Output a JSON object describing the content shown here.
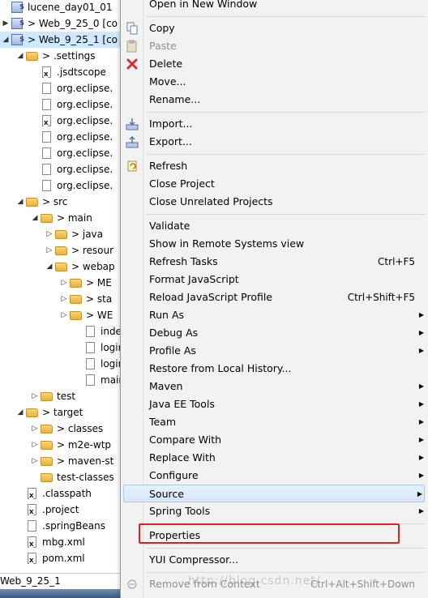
{
  "tree": {
    "rows": [
      {
        "label": "lucene_day01_01",
        "icon": "project-icon",
        "toggle": "",
        "indent": 0
      },
      {
        "label": "> Web_9_25_0 [co",
        "icon": "maven-project-icon",
        "toggle": "▶",
        "indent": 0
      },
      {
        "label": "> Web_9_25_1 [co",
        "icon": "maven-project-icon",
        "toggle": "◢",
        "indent": 0,
        "selected": true
      },
      {
        "label": "> .settings",
        "icon": "folder-icon",
        "toggle": "◢",
        "indent": 1
      },
      {
        "label": ".jsdtscope",
        "icon": "xml-file-icon",
        "toggle": "",
        "indent": 2
      },
      {
        "label": "org.eclipse.",
        "icon": "file-icon",
        "toggle": "",
        "indent": 2
      },
      {
        "label": "org.eclipse.",
        "icon": "file-icon",
        "toggle": "",
        "indent": 2
      },
      {
        "label": "org.eclipse.",
        "icon": "xml-file-icon",
        "toggle": "",
        "indent": 2
      },
      {
        "label": "org.eclipse.",
        "icon": "file-icon",
        "toggle": "",
        "indent": 2
      },
      {
        "label": "org.eclipse.",
        "icon": "file-icon",
        "toggle": "",
        "indent": 2
      },
      {
        "label": "org.eclipse.",
        "icon": "file-icon",
        "toggle": "",
        "indent": 2
      },
      {
        "label": "org.eclipse.",
        "icon": "file-icon",
        "toggle": "",
        "indent": 2
      },
      {
        "label": "> src",
        "icon": "folder-icon",
        "toggle": "◢",
        "indent": 1
      },
      {
        "label": "> main",
        "icon": "folder-icon",
        "toggle": "◢",
        "indent": 2
      },
      {
        "label": "> java",
        "icon": "folder-icon",
        "toggle": "▷",
        "indent": 3
      },
      {
        "label": "> resour",
        "icon": "folder-icon",
        "toggle": "▷",
        "indent": 3
      },
      {
        "label": "> webap",
        "icon": "folder-icon",
        "toggle": "◢",
        "indent": 3
      },
      {
        "label": "> ME",
        "icon": "folder-icon",
        "toggle": "▷",
        "indent": 4
      },
      {
        "label": "> sta",
        "icon": "folder-icon",
        "toggle": "▷",
        "indent": 4
      },
      {
        "label": "> WE",
        "icon": "folder-icon",
        "toggle": "▷",
        "indent": 4
      },
      {
        "label": "index",
        "icon": "file-icon",
        "toggle": "",
        "indent": 5
      },
      {
        "label": "login",
        "icon": "file-icon",
        "toggle": "",
        "indent": 5
      },
      {
        "label": "login",
        "icon": "file-icon",
        "toggle": "",
        "indent": 5
      },
      {
        "label": "main",
        "icon": "file-icon",
        "toggle": "",
        "indent": 5
      },
      {
        "label": "test",
        "icon": "folder-icon",
        "toggle": "▷",
        "indent": 2
      },
      {
        "label": "> target",
        "icon": "folder-icon",
        "toggle": "◢",
        "indent": 1
      },
      {
        "label": "> classes",
        "icon": "folder-icon",
        "toggle": "▷",
        "indent": 2
      },
      {
        "label": "> m2e-wtp",
        "icon": "folder-icon",
        "toggle": "▷",
        "indent": 2
      },
      {
        "label": "> maven-st",
        "icon": "folder-icon",
        "toggle": "▷",
        "indent": 2
      },
      {
        "label": "test-classes",
        "icon": "folder-icon",
        "toggle": "",
        "indent": 2
      },
      {
        "label": ".classpath",
        "icon": "xml-file-icon",
        "toggle": "",
        "indent": 1
      },
      {
        "label": ".project",
        "icon": "xml-file-icon",
        "toggle": "",
        "indent": 1
      },
      {
        "label": ".springBeans",
        "icon": "file-icon",
        "toggle": "",
        "indent": 1
      },
      {
        "label": "mbg.xml",
        "icon": "xml-file-icon",
        "toggle": "",
        "indent": 1
      },
      {
        "label": "pom.xml",
        "icon": "xml-file-icon",
        "toggle": "",
        "indent": 1
      }
    ]
  },
  "status": {
    "label": "Web_9_25_1"
  },
  "menu": {
    "items": [
      {
        "label": "Open in New Window",
        "type": "item"
      },
      {
        "type": "sep"
      },
      {
        "label": "Copy",
        "type": "item",
        "icon": "copy-icon"
      },
      {
        "label": "Paste",
        "type": "item",
        "icon": "paste-icon",
        "disabled": true
      },
      {
        "label": "Delete",
        "type": "item",
        "icon": "delete-icon"
      },
      {
        "label": "Move...",
        "type": "item"
      },
      {
        "label": "Rename...",
        "type": "item"
      },
      {
        "type": "sep"
      },
      {
        "label": "Import...",
        "type": "item",
        "icon": "import-icon"
      },
      {
        "label": "Export...",
        "type": "item",
        "icon": "export-icon"
      },
      {
        "type": "sep"
      },
      {
        "label": "Refresh",
        "type": "item",
        "icon": "refresh-icon"
      },
      {
        "label": "Close Project",
        "type": "item"
      },
      {
        "label": "Close Unrelated Projects",
        "type": "item"
      },
      {
        "type": "sep"
      },
      {
        "label": "Validate",
        "type": "item"
      },
      {
        "label": "Show in Remote Systems view",
        "type": "item"
      },
      {
        "label": "Refresh Tasks",
        "type": "item",
        "shortcut": "Ctrl+F5"
      },
      {
        "label": "Format JavaScript",
        "type": "item"
      },
      {
        "label": "Reload JavaScript Profile",
        "type": "item",
        "shortcut": "Ctrl+Shift+F5"
      },
      {
        "label": "Run As",
        "type": "item",
        "submenu": true
      },
      {
        "label": "Debug As",
        "type": "item",
        "submenu": true
      },
      {
        "label": "Profile As",
        "type": "item",
        "submenu": true
      },
      {
        "label": "Restore from Local History...",
        "type": "item"
      },
      {
        "label": "Maven",
        "type": "item",
        "submenu": true
      },
      {
        "label": "Java EE Tools",
        "type": "item",
        "submenu": true
      },
      {
        "label": "Team",
        "type": "item",
        "submenu": true
      },
      {
        "label": "Compare With",
        "type": "item",
        "submenu": true
      },
      {
        "label": "Replace With",
        "type": "item",
        "submenu": true
      },
      {
        "label": "Configure",
        "type": "item",
        "submenu": true
      },
      {
        "label": "Source",
        "type": "item",
        "submenu": true,
        "hover": true
      },
      {
        "label": "Spring Tools",
        "type": "item",
        "submenu": true
      },
      {
        "type": "sep"
      },
      {
        "label": "Properties",
        "type": "item"
      },
      {
        "type": "sep"
      },
      {
        "label": "YUI Compressor...",
        "type": "item"
      },
      {
        "type": "sep"
      },
      {
        "label": "Remove from Context",
        "type": "item",
        "icon": "remove-context-icon",
        "shortcut": "Ctrl+Alt+Shift+Down",
        "disabled": true
      }
    ]
  },
  "watermark": "http://blog.csdn.net/",
  "colors": {
    "selection": "#cde8ff",
    "hover": "#d6e6f8",
    "highlight_border": "#e02020",
    "delete_red": "#d9302c"
  }
}
